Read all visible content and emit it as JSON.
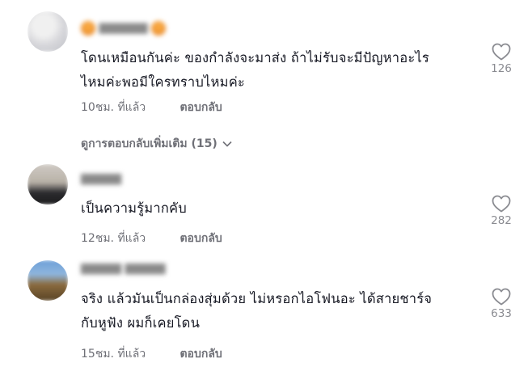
{
  "comments": [
    {
      "text_line1": "โดนเหมือนกันค่ะ ของกำลังจะมาส่ง ถ้าไม่รับจะมีปัญหาอะไร",
      "text_line2": "ไหมค่ะพอมีใครทราบไหมค่ะ",
      "time": "10ชม. ที่แล้ว",
      "reply_label": "ตอบกลับ",
      "likes": "126"
    },
    {
      "text_line1": "เป็นความรู้มากคับ",
      "time": "12ชม. ที่แล้ว",
      "reply_label": "ตอบกลับ",
      "likes": "282"
    },
    {
      "text_line1": "จริง แล้วมันเป็นกล่องสุ่มด้วย ไม่หรอกไอโฟนอะ ได้สายชาร์จ",
      "text_line2": "กับหูฟัง ผมก็เคยโดน",
      "time": "15ชม. ที่แล้ว",
      "reply_label": "ตอบกลับ",
      "likes": "633"
    }
  ],
  "more_replies_label": "ดูการตอบกลับเพิ่มเติม (15)",
  "icons": {
    "like": "heart-outline-icon",
    "expand": "chevron-down-icon"
  },
  "colors": {
    "text": "#161823",
    "muted": "#6f7077",
    "like_count": "#8a8b91"
  }
}
